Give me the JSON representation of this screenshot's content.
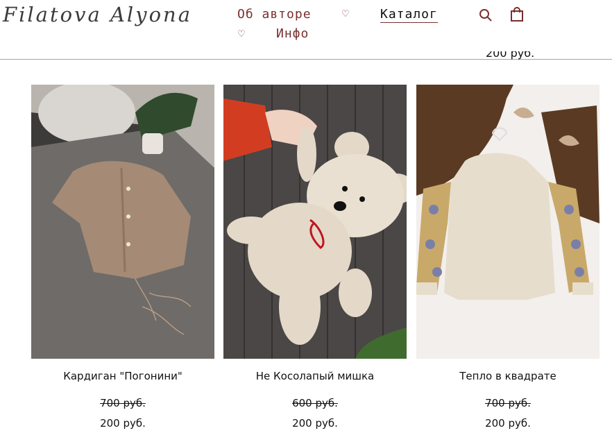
{
  "site": {
    "logo": "Filatova Alyona"
  },
  "nav": {
    "about": "Об авторе",
    "catalog": "Каталог",
    "info": "Инфо",
    "heart_glyph": "♡"
  },
  "header_icons": [
    "search-icon",
    "shopping-bag-icon"
  ],
  "cutoff_price": "200 руб.",
  "products": [
    {
      "title": "Кардиган \"Погонини\"",
      "old_price": "700 руб.",
      "price": "200 руб."
    },
    {
      "title": "Не Косолапый мишка",
      "old_price": "600 руб.",
      "price": "200 руб."
    },
    {
      "title": "Тепло в квадрате",
      "old_price": "700 руб.",
      "price": "200 руб."
    }
  ],
  "colors": {
    "nav": "#7a2e2e",
    "divider": "#b89aa2",
    "text": "#111111"
  }
}
